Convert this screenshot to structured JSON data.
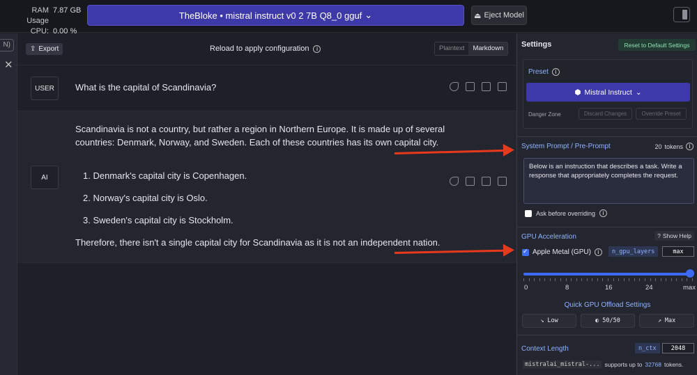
{
  "topbar": {
    "ram_label": "RAM Usage",
    "ram_value": "7.87 GB",
    "cpu_label": "CPU:",
    "cpu_value": "0.00 %",
    "model_name": "TheBloke • mistral instruct v0 2 7B Q8_0 gguf",
    "eject_label": "Eject Model"
  },
  "leftstrip": {
    "pill_text": "N)",
    "close_glyph": "✕"
  },
  "chat": {
    "export_label": "Export",
    "reload_text": "Reload to apply configuration",
    "mode_plaintext": "Plaintext",
    "mode_markdown": "Markdown",
    "user_role": "USER",
    "user_message": "What is the capital of Scandinavia?",
    "ai_role": "AI",
    "ai_intro": " Scandinavia is not a country, but rather a region in Northern Europe. It is made up of several countries: Denmark, Norway, and Sweden. Each of these countries has its own capital city.",
    "ai_list": [
      "1. Denmark's capital city is Copenhagen.",
      "2. Norway's capital city is Oslo.",
      "3. Sweden's capital city is Stockholm."
    ],
    "ai_closing": "Therefore, there isn't a single capital city for Scandinavia as it is not an independent nation."
  },
  "settings": {
    "title": "Settings",
    "reset_label": "Reset to Default Settings",
    "preset_label": "Preset",
    "preset_value": "Mistral Instruct",
    "danger_zone": "Danger Zone",
    "discard_label": "Discard Changes",
    "override_label": "Override Preset",
    "system_prompt_title": "System Prompt / Pre-Prompt",
    "token_count": "20",
    "tokens_label": "tokens",
    "system_prompt_text": "Below is an instruction that describes a task. Write a response that appropriately completes the request.",
    "ask_label": "Ask before overriding",
    "gpu_title": "GPU Acceleration",
    "show_help": "Show Help",
    "metal_label": "Apple Metal (GPU)",
    "gpu_layers_tag": "n_gpu_layers",
    "gpu_layers_value": "max",
    "slider_value": 1.0,
    "slider_ticks": [
      "0",
      "8",
      "16",
      "24",
      "max"
    ],
    "quick_title": "Quick GPU Offload Settings",
    "quick_low": "Low",
    "quick_half": "50/50",
    "quick_max": "Max",
    "ctx_title": "Context Length",
    "ctx_tag": "n_ctx",
    "ctx_value": "2048",
    "ctx_model": "mistralai_mistral-...",
    "ctx_support_pre": "supports up to",
    "ctx_support_num": "32768",
    "ctx_support_post": "tokens."
  },
  "colors": {
    "accent": "#3d39a8",
    "link_blue": "#8fb3ff",
    "annotation_arrow": "#e8391d"
  }
}
